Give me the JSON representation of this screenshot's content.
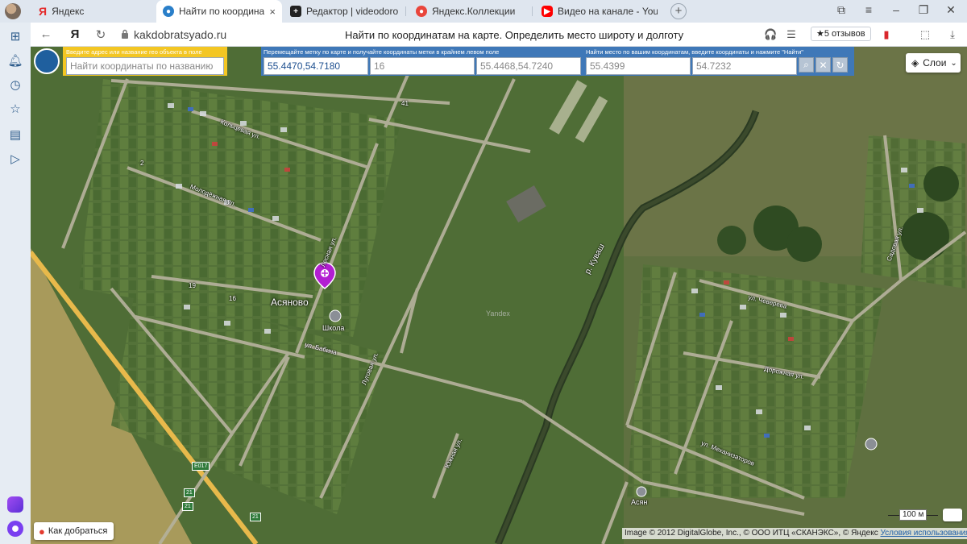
{
  "browser": {
    "tabs": [
      {
        "label": "Яндекс",
        "icon": "yandex-y-icon",
        "color": "#e42b2b",
        "active": false
      },
      {
        "label": "Найти по координатам на",
        "icon": "globe-icon",
        "color": "#2a7fc9",
        "active": true
      },
      {
        "label": "Редактор | videodorogross",
        "icon": "plus-square-icon",
        "color": "#222222",
        "active": false
      },
      {
        "label": "Яндекс.Коллекции",
        "icon": "collections-icon",
        "color": "#e9453b",
        "active": false
      },
      {
        "label": "Видео на канале - YouTub",
        "icon": "youtube-icon",
        "color": "#ff0000",
        "active": false
      }
    ],
    "url": "kakdobratsyado.ru",
    "page_title": "Найти по координатам на карте. Определить место широту и долготу",
    "reviews": "★5 отзывов"
  },
  "panels": {
    "search_label": "Введите адрес или название гео объекта в поле",
    "search_placeholder": "Найти координаты по названию",
    "move_label": "Перемещайте метку по карте и получайте координаты метки в крайнем левом поле",
    "move_values": [
      "55.4470,54.7180",
      "16",
      "55.4468,54.7240"
    ],
    "find_label": "Найти место по вашим координатам, введите координаты и нажмите \"Найти\"",
    "find_values": [
      "55.4399",
      "54.7232"
    ]
  },
  "map": {
    "layers_label": "Слои",
    "route_label": "Как добраться",
    "scale_label": "100 м",
    "copyright": "Image © 2012 DigitalGlobe, Inc., © ООО ИТЦ «СКАНЭКС», © Яндекс",
    "terms_link": "Условия использования",
    "village_name": "Асяново",
    "school_label": "Школа",
    "river_label": "р. Куваш",
    "watermark": "Yandex",
    "road_badge_e017": "E017",
    "road_badge_21a": "21",
    "road_badge_21b": "21",
    "road_badge_21c": "21",
    "village2_label": "Асян",
    "streets": {
      "s1": "Кольцевая ул.",
      "s2": "Молодёжная ул.",
      "s3": "ул. Бабича",
      "s4": "ул. Чеверева",
      "s5": "Дорожная ул.",
      "s6": "ул. Механизаторов",
      "s7": "Садовая ул.",
      "s8": "Лесная ул.",
      "s9": "Луговая ул.",
      "s10": "Южная ул."
    },
    "house_numbers": {
      "h1": "19",
      "h2": "16",
      "h3": "41",
      "h4": "2"
    }
  }
}
